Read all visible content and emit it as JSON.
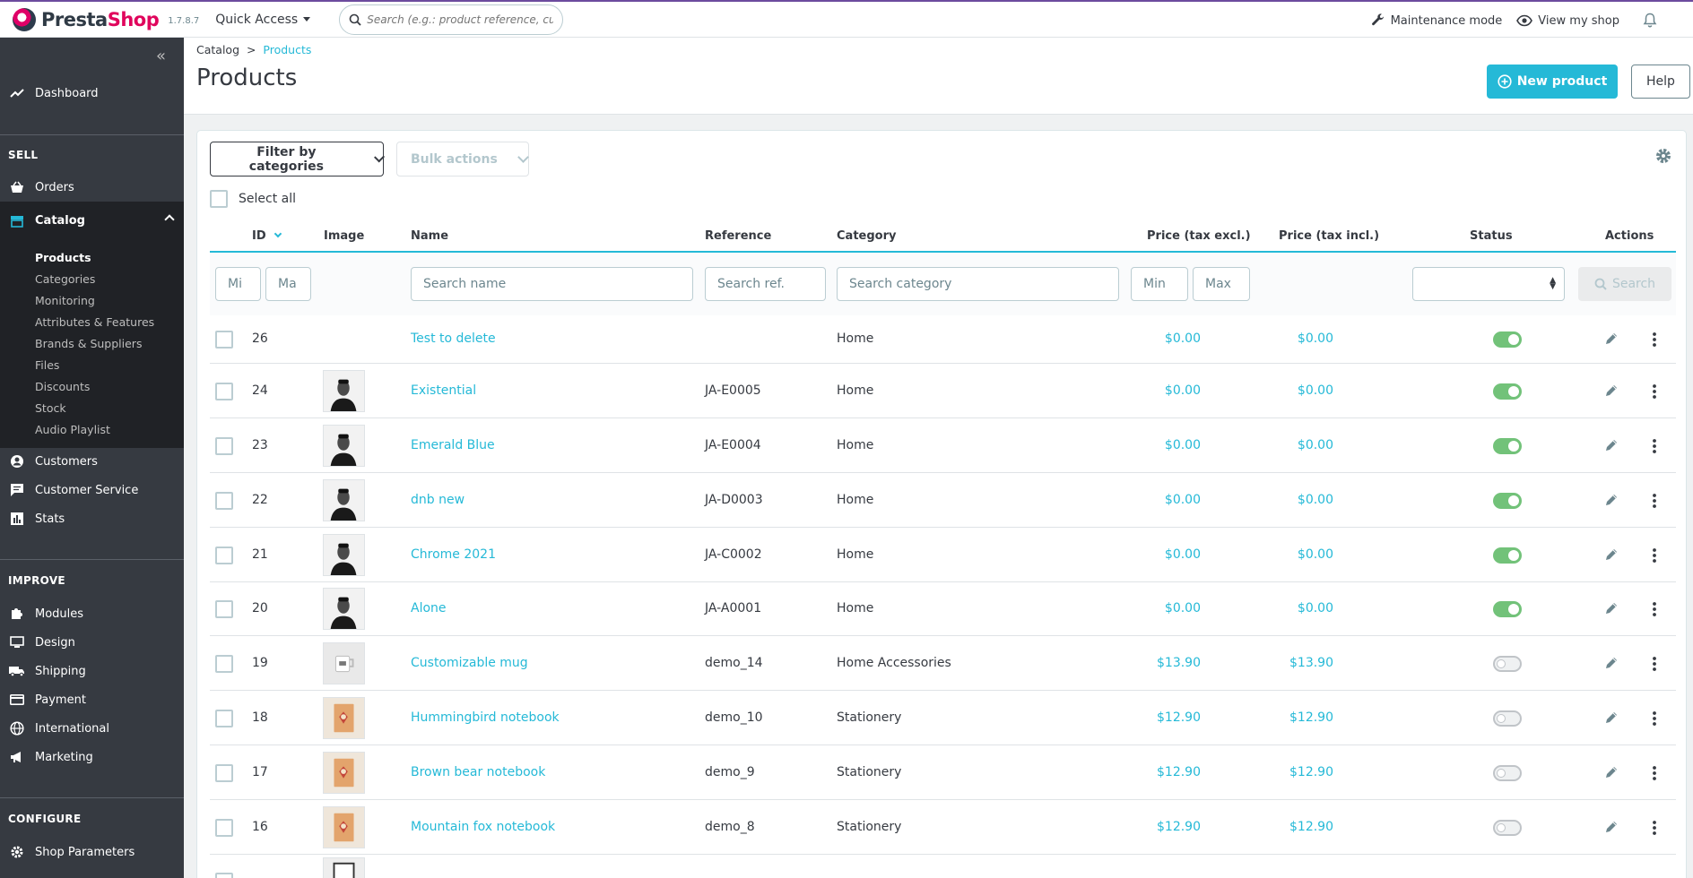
{
  "header": {
    "brand_main": "Presta",
    "brand_accent": "Shop",
    "version": "1.7.8.7",
    "quick_access": "Quick Access",
    "search_placeholder": "Search (e.g.: product reference, custon",
    "maintenance": "Maintenance mode",
    "view_shop": "View my shop"
  },
  "sidebar": {
    "dashboard": "Dashboard",
    "sell_title": "SELL",
    "orders": "Orders",
    "catalog": "Catalog",
    "catalog_sub": [
      "Products",
      "Categories",
      "Monitoring",
      "Attributes & Features",
      "Brands & Suppliers",
      "Files",
      "Discounts",
      "Stock",
      "Audio Playlist"
    ],
    "customers": "Customers",
    "customer_service": "Customer Service",
    "stats": "Stats",
    "improve_title": "IMPROVE",
    "modules": "Modules",
    "design": "Design",
    "shipping": "Shipping",
    "payment": "Payment",
    "international": "International",
    "marketing": "Marketing",
    "configure_title": "CONFIGURE",
    "shop_parameters": "Shop Parameters"
  },
  "page": {
    "breadcrumb_parent": "Catalog",
    "breadcrumb_sep": ">",
    "breadcrumb_current": "Products",
    "title": "Products",
    "new_product": "New product",
    "help": "Help"
  },
  "toolbar": {
    "filter_categories": "Filter by categories",
    "bulk_actions": "Bulk actions",
    "select_all": "Select all"
  },
  "table": {
    "columns": {
      "id": "ID",
      "image": "Image",
      "name": "Name",
      "reference": "Reference",
      "category": "Category",
      "price_excl": "Price (tax excl.)",
      "price_incl": "Price (tax incl.)",
      "status": "Status",
      "actions": "Actions"
    },
    "filters": {
      "id_min": "Mi",
      "id_max": "Ma",
      "name": "Search name",
      "reference": "Search ref.",
      "category": "Search category",
      "price_min": "Min",
      "price_max": "Max",
      "search_button": "Search"
    },
    "rows": [
      {
        "id": "26",
        "name": "Test to delete",
        "reference": "",
        "category": "Home",
        "price_excl": "$0.00",
        "price_incl": "$0.00",
        "status": true,
        "image": "none"
      },
      {
        "id": "24",
        "name": "Existential",
        "reference": "JA-E0005",
        "category": "Home",
        "price_excl": "$0.00",
        "price_incl": "$0.00",
        "status": true,
        "image": "portrait"
      },
      {
        "id": "23",
        "name": "Emerald Blue",
        "reference": "JA-E0004",
        "category": "Home",
        "price_excl": "$0.00",
        "price_incl": "$0.00",
        "status": true,
        "image": "portrait"
      },
      {
        "id": "22",
        "name": "dnb new",
        "reference": "JA-D0003",
        "category": "Home",
        "price_excl": "$0.00",
        "price_incl": "$0.00",
        "status": true,
        "image": "portrait"
      },
      {
        "id": "21",
        "name": "Chrome 2021",
        "reference": "JA-C0002",
        "category": "Home",
        "price_excl": "$0.00",
        "price_incl": "$0.00",
        "status": true,
        "image": "portrait"
      },
      {
        "id": "20",
        "name": "Alone",
        "reference": "JA-A0001",
        "category": "Home",
        "price_excl": "$0.00",
        "price_incl": "$0.00",
        "status": true,
        "image": "portrait"
      },
      {
        "id": "19",
        "name": "Customizable mug",
        "reference": "demo_14",
        "category": "Home Accessories",
        "price_excl": "$13.90",
        "price_incl": "$13.90",
        "status": false,
        "image": "mug"
      },
      {
        "id": "18",
        "name": "Hummingbird notebook",
        "reference": "demo_10",
        "category": "Stationery",
        "price_excl": "$12.90",
        "price_incl": "$12.90",
        "status": false,
        "image": "notebook"
      },
      {
        "id": "17",
        "name": "Brown bear notebook",
        "reference": "demo_9",
        "category": "Stationery",
        "price_excl": "$12.90",
        "price_incl": "$12.90",
        "status": false,
        "image": "notebook"
      },
      {
        "id": "16",
        "name": "Mountain fox notebook",
        "reference": "demo_8",
        "category": "Stationery",
        "price_excl": "$12.90",
        "price_incl": "$12.90",
        "status": false,
        "image": "notebook"
      }
    ]
  },
  "colors": {
    "accent": "#25b9d7",
    "sidebar": "#363a41",
    "toggle_on": "#72c279",
    "brand": "#e0055c"
  }
}
